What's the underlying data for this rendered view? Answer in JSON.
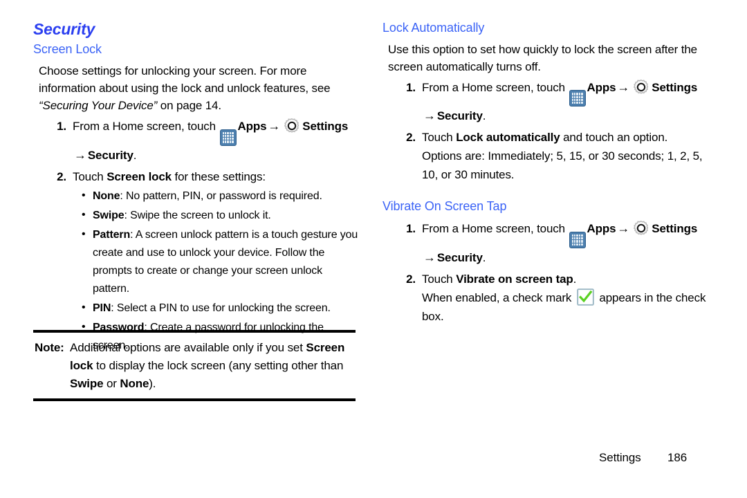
{
  "document": {
    "left_column": {
      "chapter_heading": "Security",
      "section_heading": "Screen Lock",
      "intro_part1": "Choose settings for unlocking your screen. For more information about using the lock and unlock features, see ",
      "intro_italic": "“Securing Your Device”",
      "intro_part2": " on page 14.",
      "step1": {
        "number": "1.",
        "text_before_apps": "From a Home screen, touch ",
        "apps_label": "Apps",
        "arrow": "→",
        "settings_label": "Settings",
        "continuation_arrow": "→",
        "continuation_bold": "Security",
        "continuation_period": "."
      },
      "step2": {
        "number": "2.",
        "text_before": "Touch ",
        "bold": "Screen lock",
        "text_after": " for these settings:"
      },
      "bullets": [
        {
          "bullet": "•",
          "term": "None",
          "desc": ": No pattern, PIN, or password is required."
        },
        {
          "bullet": "•",
          "term": "Swipe",
          "desc": ": Swipe the screen to unlock it."
        },
        {
          "bullet": "•",
          "term": "Pattern",
          "desc": ": A screen unlock pattern is a touch gesture you create and use to unlock your device. Follow the prompts to create or change your screen unlock pattern."
        },
        {
          "bullet": "•",
          "term": "PIN",
          "desc": ": Select a PIN to use for unlocking the screen."
        },
        {
          "bullet": "•",
          "term": "Password",
          "desc": ": Create a password for unlocking the screen."
        }
      ],
      "note": {
        "label": "Note:",
        "part1": "Additional options are available only if you set ",
        "bold1": "Screen lock",
        "part2": " to display the lock screen (any setting other than ",
        "bold2": "Swipe",
        "part3": " or ",
        "bold3": "None",
        "part4": ")."
      }
    },
    "right_column": {
      "section_heading_1": "Lock Automatically",
      "intro": "Use this option to set how quickly to lock the screen after the screen automatically turns off.",
      "step1": {
        "number": "1.",
        "text_before_apps": "From a Home screen, touch ",
        "apps_label": "Apps",
        "arrow": "→",
        "settings_label": "Settings",
        "continuation_arrow": "→",
        "continuation_bold": "Security",
        "continuation_period": "."
      },
      "step2": {
        "number": "2.",
        "text_before": "Touch ",
        "bold": "Lock automatically",
        "text_after": " and touch an option.",
        "options_text": "Options are: Immediately; 5, 15, or 30 seconds; 1, 2, 5, 10, or 30 minutes."
      },
      "section_heading_2": "Vibrate On Screen Tap",
      "step3": {
        "number": "1.",
        "text_before_apps": "From a Home screen, touch ",
        "apps_label": "Apps",
        "arrow": "→",
        "settings_label": "Settings",
        "continuation_arrow": "→",
        "continuation_bold": "Security",
        "continuation_period": "."
      },
      "step4": {
        "number": "2.",
        "text_before": "Touch ",
        "bold": "Vibrate on screen tap",
        "text_after": ".",
        "enabled_part1": "When enabled, a check mark ",
        "enabled_part2": " appears in the check box."
      }
    },
    "footer": {
      "label": "Settings",
      "page_number": "186"
    },
    "icons": {
      "apps": "apps-grid-icon",
      "settings": "gear-icon",
      "checkmark": "green-check-icon",
      "arrow": "right-arrow-icon"
    },
    "colors": {
      "chapter_heading": "#2b3ff0",
      "section_heading": "#3b63f6",
      "body_text": "#000000",
      "apps_icon_bg": "#4c7fae",
      "check_green": "#5bd124",
      "note_rule": "#000000"
    }
  }
}
